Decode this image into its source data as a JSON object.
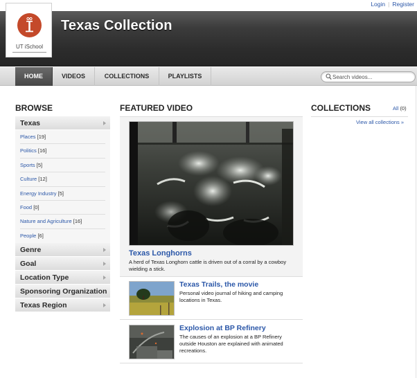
{
  "top_links": {
    "login": "Login",
    "separator": "|",
    "register": "Register"
  },
  "logo": {
    "text": "UT iSchool",
    "icon": "ischool-logo-icon",
    "color": "#c4492a"
  },
  "header": {
    "title": "Texas Collection"
  },
  "nav": {
    "items": [
      {
        "label": "HOME",
        "active": true
      },
      {
        "label": "VIDEOS",
        "active": false
      },
      {
        "label": "COLLECTIONS",
        "active": false
      },
      {
        "label": "PLAYLISTS",
        "active": false
      }
    ],
    "search_placeholder": "Search videos..."
  },
  "browse": {
    "title": "BROWSE",
    "expanded": {
      "label": "Texas",
      "items": [
        {
          "label": "Places",
          "count": "[19]"
        },
        {
          "label": "Politics",
          "count": "[16]"
        },
        {
          "label": "Sports",
          "count": "[5]"
        },
        {
          "label": "Culture",
          "count": "[12]"
        },
        {
          "label": "Energy Industry",
          "count": "[5]"
        },
        {
          "label": "Food",
          "count": "[0]"
        },
        {
          "label": "Nature and Agriculture",
          "count": "[16]"
        },
        {
          "label": "People",
          "count": "[6]"
        }
      ]
    },
    "categories": [
      {
        "label": "Genre"
      },
      {
        "label": "Goal"
      },
      {
        "label": "Location Type"
      },
      {
        "label": "Sponsoring Organization"
      },
      {
        "label": "Texas Region"
      }
    ]
  },
  "featured": {
    "title": "FEATURED VIDEO",
    "video": {
      "name": "Texas Longhorns",
      "description": "A herd of Texas Longhorn cattle is driven out of a corral by a cowboy wielding a stick."
    },
    "list": [
      {
        "name": "Texas Trails, the movie",
        "description": "Personal video journal of hiking and camping locations in Texas."
      },
      {
        "name": "Explosion at BP Refinery",
        "description": "The causes of an explosion at a BP Refinery outside Houston are explained with animated recreations."
      }
    ]
  },
  "collections": {
    "title": "COLLECTIONS",
    "all_label": "All",
    "all_count": "(0)",
    "view_all": "View all collections »"
  },
  "colors": {
    "link": "#2b57a8",
    "header_dark": "#2c2c2c",
    "logo_red": "#c4492a"
  }
}
